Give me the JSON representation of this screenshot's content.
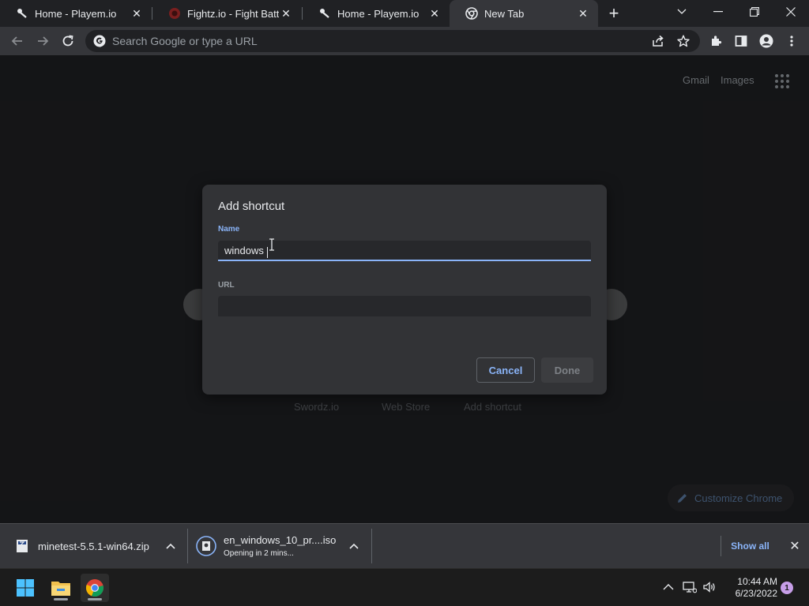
{
  "tabs": [
    {
      "title": "Home - Playem.io",
      "icon": "playem-icon"
    },
    {
      "title": "Fightz.io - Fight Battle Game",
      "icon": "fightz-icon"
    },
    {
      "title": "Home - Playem.io",
      "icon": "playem-icon"
    },
    {
      "title": "New Tab",
      "icon": "chrome-icon"
    }
  ],
  "omnibox": {
    "placeholder": "Search Google or type a URL",
    "value": ""
  },
  "ntp": {
    "gmail": "Gmail",
    "images": "Images",
    "shortcuts": [
      "Swordz.io",
      "Web Store",
      "Add shortcut"
    ],
    "customize": "Customize Chrome"
  },
  "dialog": {
    "title": "Add shortcut",
    "name_label": "Name",
    "name_value": "windows",
    "url_label": "URL",
    "url_value": "",
    "cancel": "Cancel",
    "done": "Done"
  },
  "downloads": {
    "items": [
      {
        "name": "minetest-5.5.1-win64.zip",
        "status": ""
      },
      {
        "name": "en_windows_10_pr....iso",
        "status": "Opening in 2 mins..."
      }
    ],
    "show_all": "Show all"
  },
  "taskbar": {
    "time": "10:44 AM",
    "date": "6/23/2022",
    "notifications": "1"
  },
  "colors": {
    "accent": "#8ab4f8",
    "background": "#202124",
    "toolbar": "#35363a",
    "dialog": "#323336"
  }
}
